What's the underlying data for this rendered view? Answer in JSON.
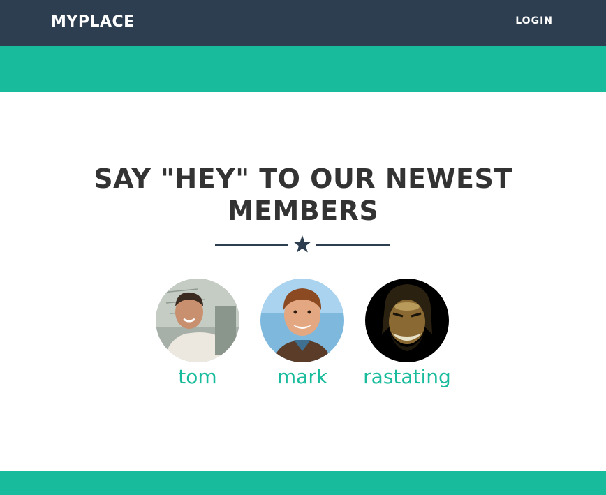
{
  "navbar": {
    "brand": "MYPLACE",
    "login_label": "LOGIN",
    "background": "#2c3e50"
  },
  "accent_color": "#18bc9c",
  "section": {
    "title": "SAY \"HEY\" TO OUR NEWEST MEMBERS",
    "divider_icon": "star-icon"
  },
  "members": [
    {
      "name": "tom"
    },
    {
      "name": "mark"
    },
    {
      "name": "rastating"
    }
  ]
}
